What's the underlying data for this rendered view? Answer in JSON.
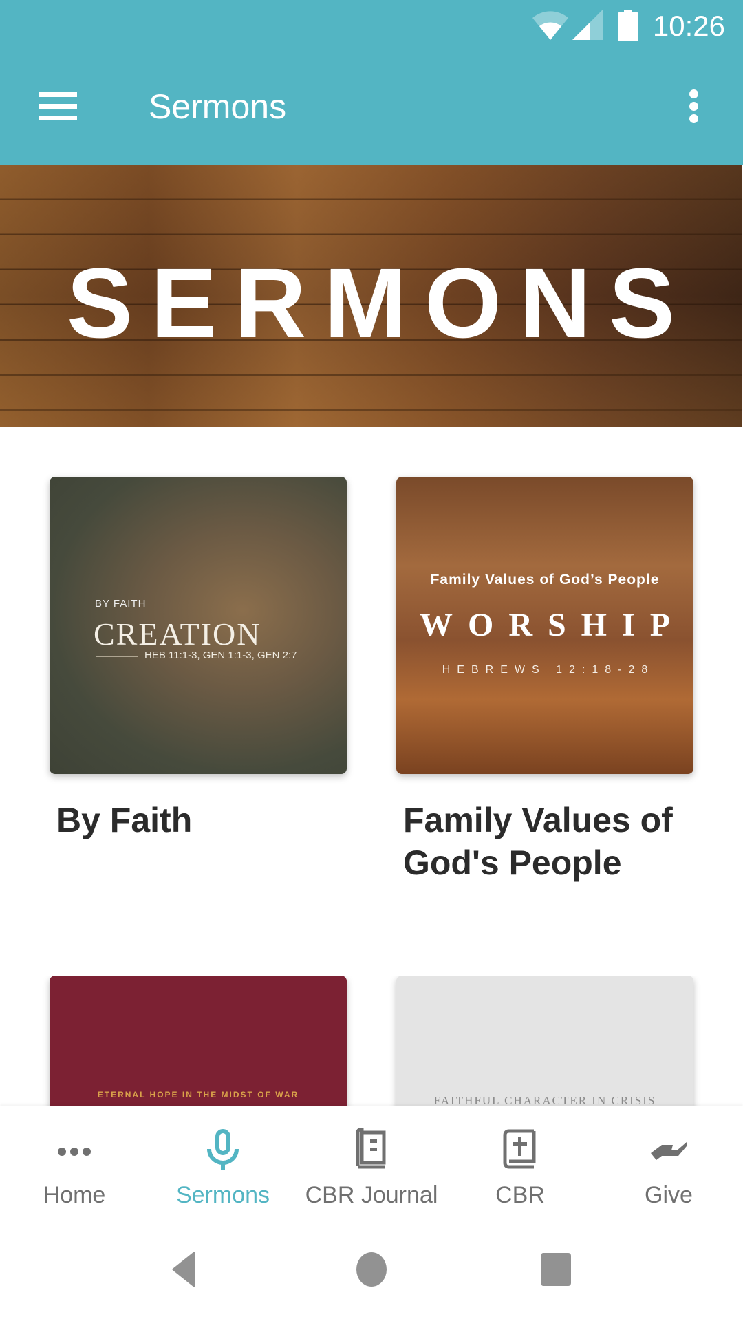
{
  "status_bar": {
    "time": "10:26",
    "icons": [
      "wifi-icon",
      "signal-icon",
      "battery-icon"
    ]
  },
  "app_bar": {
    "title": "Sermons",
    "menu_icon": "hamburger-menu-icon",
    "overflow_icon": "more-vert-icon"
  },
  "banner": {
    "text": "SERMONS"
  },
  "series": [
    {
      "title": "By Faith",
      "art": {
        "kicker": "BY FAITH",
        "headline": "CREATION",
        "reference": "HEB 11:1-3, GEN 1:1-3, GEN 2:7"
      }
    },
    {
      "title": "Family Values of God's People",
      "art": {
        "kicker": "Family Values of God’s People",
        "headline": "WORSHIP",
        "reference": "HEBREWS 12:18-28"
      }
    },
    {
      "title": "",
      "art": {
        "subtitle": "ETERNAL HOPE IN THE MIDST OF WAR"
      }
    },
    {
      "title": "",
      "art": {
        "subtitle": "FAITHFUL CHARACTER IN CRISIS"
      }
    }
  ],
  "bottom_nav": {
    "items": [
      {
        "label": "Home",
        "icon": "more-horiz-icon",
        "active": false
      },
      {
        "label": "Sermons",
        "icon": "microphone-icon",
        "active": true
      },
      {
        "label": "CBR Journal",
        "icon": "journal-icon",
        "active": false
      },
      {
        "label": "CBR",
        "icon": "bible-icon",
        "active": false
      },
      {
        "label": "Give",
        "icon": "giving-hand-icon",
        "active": false
      }
    ]
  },
  "system_nav": {
    "buttons": [
      "back",
      "home",
      "recents"
    ]
  },
  "colors": {
    "accent": "#53B5C3",
    "inactive": "#707070",
    "title_text": "#2b2b2b"
  }
}
